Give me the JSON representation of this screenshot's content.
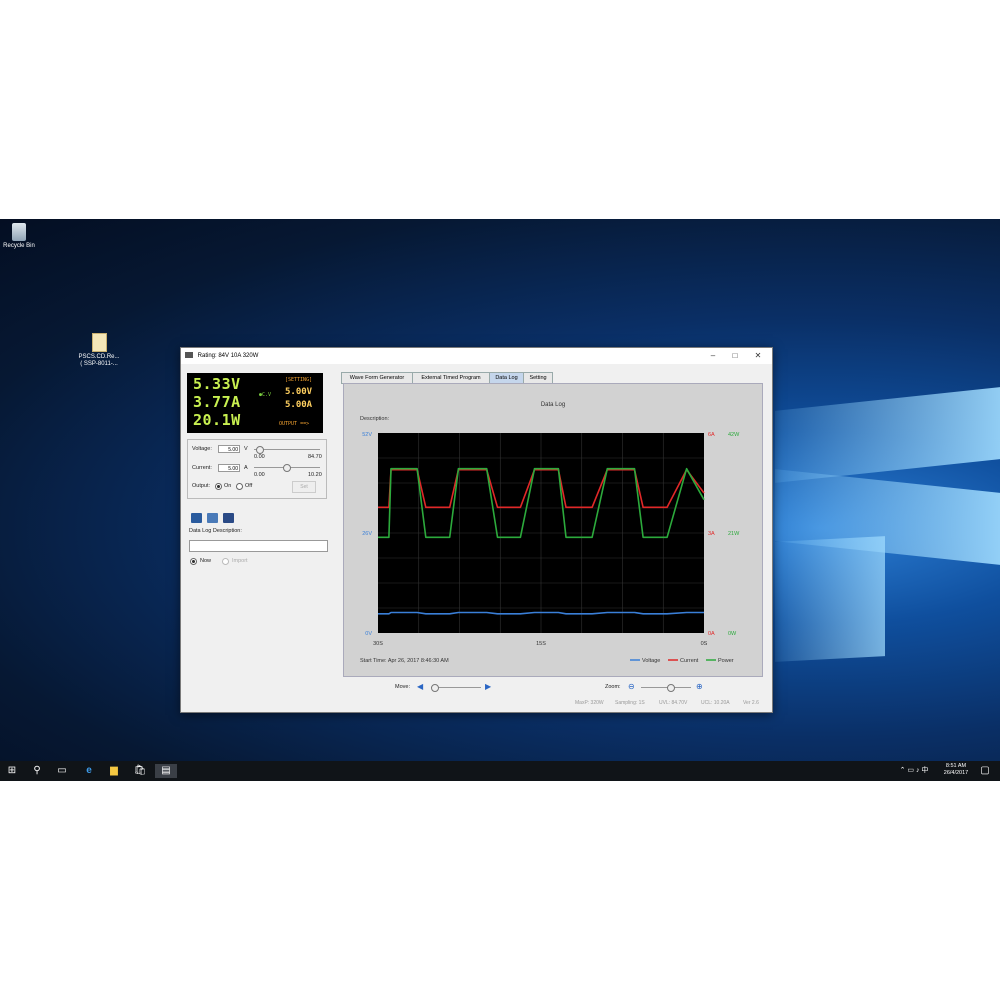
{
  "desktop": {
    "recycle_label": "Recycle Bin",
    "file_label_1": "PSCS.CD.Re...",
    "file_label_2": "( SSP-8011-..."
  },
  "window": {
    "title": "Rating: 84V 10A 320W"
  },
  "readout": {
    "voltage": "5.33V",
    "current": "3.77A",
    "power": "20.1W",
    "mode": "●C.V",
    "setting_label": "[SETTING]",
    "set_voltage": "5.00V",
    "set_current": "5.00A",
    "output_label": "OUTPUT ==>"
  },
  "controls": {
    "voltage_label": "Voltage:",
    "voltage_value": "5.00",
    "voltage_unit": "V",
    "voltage_min": "0.00",
    "voltage_max": "84.70",
    "current_label": "Current:",
    "current_value": "5.00",
    "current_unit": "A",
    "current_min": "0.00",
    "current_max": "10.20",
    "output_label": "Output:",
    "on_label": "On",
    "off_label": "Off",
    "set_button": "Set",
    "desc_label": "Data Log Description:",
    "now_label": "Now",
    "import_label": "Import"
  },
  "tabs": [
    "Wave Form Generator",
    "External Timed Program",
    "Data Log",
    "Setting"
  ],
  "panel": {
    "description_label": "Description:",
    "start_time": "Start Time: Apr 26, 2017 8:46:30 AM",
    "move_label": "Move:",
    "zoom_label": "Zoom:"
  },
  "status": {
    "maxp": "MaxP: 320W",
    "sampling": "Sampling: 1S",
    "uvl": "UVL: 84.70V",
    "ucl": "UCL: 10.20A",
    "ver": "Ver 2.6"
  },
  "taskbar": {
    "time": "8:51 AM",
    "date": "26/4/2017"
  },
  "chart_data": {
    "type": "line",
    "title": "Data Log",
    "x_tick_labels": [
      "30S",
      "15S",
      "0S"
    ],
    "y_left_ticks": [
      "52V",
      "26V",
      "0V"
    ],
    "y_right_current_ticks": [
      "6A",
      "3A",
      "0A"
    ],
    "y_right_power_ticks": [
      "42W",
      "21W",
      "0W"
    ],
    "x": [
      30,
      29.9,
      29,
      28.8,
      27.8,
      26.4,
      25.6,
      24,
      23.4,
      22.6,
      21.4,
      20,
      19,
      17.6,
      16.9,
      15.6,
      14.8,
      13.4,
      12.7,
      11.2,
      10.3,
      8.9,
      7.9,
      6.4,
      5.6,
      4.2,
      3.4,
      1.6,
      0
    ],
    "series": [
      {
        "name": "Voltage",
        "color": "#3a7fd8",
        "values": [
          5.0,
          5.0,
          5.0,
          5.33,
          5.33,
          5.33,
          5.0,
          5.0,
          5.0,
          5.33,
          5.33,
          5.33,
          5.0,
          5.0,
          5.0,
          5.33,
          5.33,
          5.33,
          5.0,
          5.0,
          5.0,
          5.33,
          5.33,
          5.33,
          5.0,
          5.0,
          5.0,
          5.33,
          5.33
        ]
      },
      {
        "name": "Current",
        "color": "#e02828",
        "values": [
          3.77,
          3.77,
          3.77,
          4.9,
          4.9,
          4.9,
          3.77,
          3.77,
          3.77,
          4.9,
          4.9,
          4.9,
          3.77,
          3.77,
          3.77,
          4.9,
          4.9,
          4.9,
          3.77,
          3.77,
          3.77,
          4.9,
          4.9,
          4.9,
          3.77,
          3.77,
          3.77,
          4.9,
          4.2
        ]
      },
      {
        "name": "Power",
        "color": "#2caa3c",
        "values": [
          20.1,
          20.1,
          20.1,
          34.5,
          34.5,
          34.5,
          20.1,
          20.1,
          20.1,
          34.5,
          34.5,
          34.5,
          20.1,
          20.1,
          20.1,
          34.5,
          34.5,
          34.5,
          20.1,
          20.1,
          20.1,
          34.5,
          34.5,
          34.5,
          20.1,
          20.1,
          20.1,
          34.5,
          28
        ]
      }
    ],
    "xlim": [
      30,
      0
    ],
    "grid": true,
    "legend": "bottom-right"
  }
}
